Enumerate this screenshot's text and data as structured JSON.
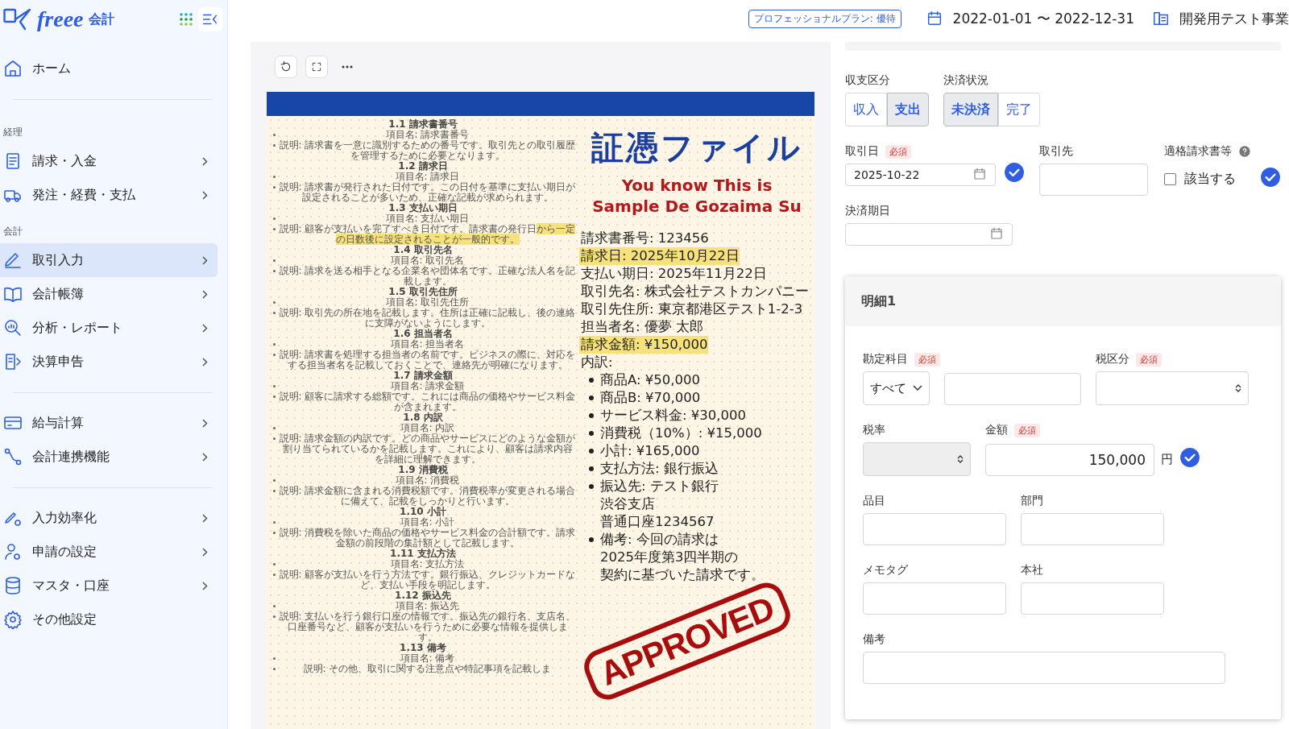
{
  "header": {
    "logo": "freee",
    "logo_suffix": "会計",
    "plan_badge": "プロフェッショナルプラン: 優待",
    "period": "2022-01-01 〜 2022-12-31",
    "company": "開発用テスト事業"
  },
  "sidebar": {
    "groups": [
      {
        "divider_before": false,
        "items": [
          {
            "label": "ホーム",
            "selected": false,
            "has_submenu": false
          }
        ]
      },
      {
        "divider_before": true,
        "heading": "経理",
        "items": [
          {
            "label": "請求・入金",
            "selected": false,
            "has_submenu": true
          },
          {
            "label": "発注・経費・支払",
            "selected": false,
            "has_submenu": true
          }
        ]
      },
      {
        "divider_before": false,
        "heading": "会計",
        "items": [
          {
            "label": "取引入力",
            "selected": true,
            "has_submenu": true
          },
          {
            "label": "会計帳簿",
            "selected": false,
            "has_submenu": true
          },
          {
            "label": "分析・レポート",
            "selected": false,
            "has_submenu": true
          },
          {
            "label": "決算申告",
            "selected": false,
            "has_submenu": true
          }
        ]
      },
      {
        "divider_before": true,
        "items": [
          {
            "label": "給与計算",
            "selected": false,
            "has_submenu": true
          },
          {
            "label": "会計連携機能",
            "selected": false,
            "has_submenu": true
          }
        ]
      },
      {
        "divider_before": true,
        "items": [
          {
            "label": "入力効率化",
            "selected": false,
            "has_submenu": true
          },
          {
            "label": "申請の設定",
            "selected": false,
            "has_submenu": true
          },
          {
            "label": "マスタ・口座",
            "selected": false,
            "has_submenu": true
          },
          {
            "label": "その他設定",
            "selected": false,
            "has_submenu": false
          }
        ]
      }
    ]
  },
  "document": {
    "sections": [
      {
        "heading": "1.1 請求書番号",
        "item": "項目名: 請求書番号",
        "desc": "説明: 請求書を一意に識別するための番号です。取引先との取引履歴を管理するために必要となります。"
      },
      {
        "heading": "1.2 請求日",
        "item": "項目名: 請求日",
        "desc": "説明: 請求書が発行された日付です。この日付を基準に支払い期日が設定されることが多いため、正確な記載が求められます。"
      },
      {
        "heading": "1.3 支払い期日",
        "item": "項目名: 支払い期日",
        "desc": "説明: 顧客が支払いを完了すべき日付です。請求書の発行日",
        "highlight": "から一定の日数後に設定されることが一般的です。"
      },
      {
        "heading": "1.4 取引先名",
        "item": "項目名: 取引先名",
        "desc": "説明: 請求を送る相手となる企業名や団体名です。正確な法人名を記載します。"
      },
      {
        "heading": "1.5 取引先住所",
        "item": "項目名: 取引先住所",
        "desc": "説明: 取引先の所在地を記載します。住所は正確に記載し、後の連絡に支障がないようにします。"
      },
      {
        "heading": "1.6 担当者名",
        "item": "項目名: 担当者名",
        "desc": "説明: 請求書を処理する担当者の名前です。ビジネスの際に、対応をする担当者名を記載しておくことで、連絡先が明確になります。"
      },
      {
        "heading": "1.7 請求金額",
        "item": "項目名: 請求金額",
        "desc": "説明: 顧客に請求する総額です。これには商品の価格やサービス料金が含まれます。"
      },
      {
        "heading": "1.8 内訳",
        "item": "項目名: 内訳",
        "desc": "説明: 請求金額の内訳です。どの商品やサービスにどのような金額が割り当てられているかを記載します。これにより、顧客は請求内容を詳細に理解できます。"
      },
      {
        "heading": "1.9 消費税",
        "item": "項目名: 消費税",
        "desc": "説明: 請求金額に含まれる消費税額です。消費税率が変更される場合に備えて、記載をしっかりと行います。"
      },
      {
        "heading": "1.10 小計",
        "item": "項目名: 小計",
        "desc": "説明: 消費税を除いた商品の価格やサービス料金の合計額です。請求金額の前段階の集計額として記載します。"
      },
      {
        "heading": "1.11 支払方法",
        "item": "項目名: 支払方法",
        "desc": "説明: 顧客が支払いを行う方法です。銀行振込、クレジットカードなど、支払い手段を明記します。"
      },
      {
        "heading": "1.12 振込先",
        "item": "項目名: 振込先",
        "desc": "説明: 支払いを行う銀行口座の情報です。振込先の銀行名、支店名、口座番号など、顧客が支払いを行うために必要な情報を提供します。"
      },
      {
        "heading": "1.13 備考",
        "item": "項目名: 備考",
        "desc": "説明: その他、取引に関する注意点や特記事項を記載しま"
      }
    ],
    "title": "証憑ファイル",
    "subtitle": [
      "You know This is",
      "Sample De Gozaima Su"
    ],
    "lines": [
      {
        "text": "請求書番号: 123456",
        "highlighted": false
      },
      {
        "text": "請求日: 2025年10月22日",
        "highlighted": true
      },
      {
        "text": "支払い期日: 2025年11月22日",
        "highlighted": false
      },
      {
        "text": "取引先名: 株式会社テストカンパニー",
        "highlighted": false
      },
      {
        "text": "取引先住所: 東京都港区テスト1-2-3",
        "highlighted": false
      },
      {
        "text": "担当者名: 優夢 太郎",
        "highlighted": false
      },
      {
        "text": "請求金額: ¥150,000",
        "highlighted": true
      },
      {
        "text": "内訳:",
        "highlighted": false
      }
    ],
    "breakdown": [
      {
        "lines": [
          "商品A: ¥50,000"
        ]
      },
      {
        "lines": [
          "商品B: ¥70,000"
        ]
      },
      {
        "lines": [
          "サービス料金: ¥30,000"
        ]
      },
      {
        "lines": [
          "消費税（10%）: ¥15,000"
        ]
      },
      {
        "lines": [
          "小計: ¥165,000"
        ]
      },
      {
        "lines": [
          "支払方法: 銀行振込"
        ]
      },
      {
        "lines": [
          "振込先: テスト銀行",
          "渋谷支店",
          "普通口座1234567"
        ]
      },
      {
        "lines": [
          "備考: 今回の請求は",
          "2025年度第3四半期の",
          "契約に基づいた請求です。"
        ]
      }
    ],
    "stamp": "APPROVED"
  },
  "form": {
    "type_group": {
      "label": "収支区分",
      "options": [
        {
          "label": "収入",
          "selected": false
        },
        {
          "label": "支出",
          "selected": true
        }
      ]
    },
    "status_group": {
      "label": "決済状況",
      "options": [
        {
          "label": "未決済",
          "selected": true
        },
        {
          "label": "完了",
          "selected": false
        }
      ]
    },
    "transaction_date": {
      "label": "取引日",
      "required_badge": "必須",
      "value": "2025-10-22"
    },
    "partner": {
      "label": "取引先"
    },
    "invoice": {
      "label": "適格請求書等",
      "checkbox_label": "該当する",
      "checked": false
    },
    "due_date": {
      "label": "決済期日"
    },
    "detail": {
      "title": "明細1",
      "account": {
        "label": "勘定科目",
        "required_badge": "必須",
        "select_value": "すべて"
      },
      "tax_category": {
        "label": "税区分",
        "required_badge": "必須"
      },
      "tax_rate": {
        "label": "税率",
        "disabled": true
      },
      "amount": {
        "label": "金額",
        "required_badge": "必須",
        "value": "150,000",
        "unit": "円"
      },
      "fields": [
        {
          "label": "品目"
        },
        {
          "label": "部門"
        },
        {
          "label": "メモタグ"
        },
        {
          "label": "本社"
        }
      ],
      "memo": {
        "label": "備考"
      }
    }
  }
}
